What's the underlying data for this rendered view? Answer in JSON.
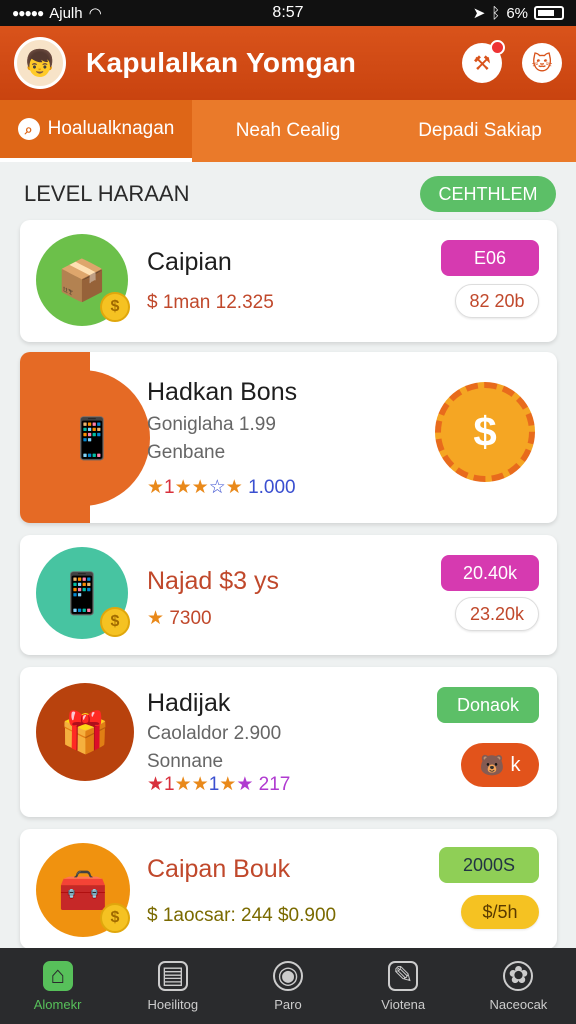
{
  "status_bar": {
    "carrier": "Ajulh",
    "time": "8:57",
    "battery": "6%"
  },
  "header": {
    "title": "Kapulalkan Yomgan"
  },
  "tabs": [
    {
      "label": "Hoalualknagan"
    },
    {
      "label": "Neah Cealig"
    },
    {
      "label": "Depadi Sakiap"
    }
  ],
  "section": {
    "title": "LEVEL HARAAN",
    "action": "CEHTHLEM"
  },
  "cards": [
    {
      "title": "Caipian",
      "line1": "$ 1man 12.325",
      "badge": "E06",
      "value": "82 20b"
    },
    {
      "title": "Hadkan Bons",
      "line1": "Goniglaha 1.99",
      "line2": "Genbane",
      "stars": "1.000"
    },
    {
      "title": "Najad $3 ys",
      "stars": "7300",
      "badge": "20.40k",
      "value": "23.20k"
    },
    {
      "title": "Hadijak",
      "line1": "Caolaldor 2.900",
      "line2": "Sonnane",
      "stars": "217",
      "badge": "Donaok",
      "value_icon_text": "k"
    },
    {
      "title": "Caipan Bouk",
      "line1": "$ 1aocsar: 244  $0.900",
      "badge": "2000S",
      "value": "$/5h"
    }
  ],
  "bottom_nav": [
    {
      "label": "Alomekr"
    },
    {
      "label": "Hoeilitog"
    },
    {
      "label": "Paro"
    },
    {
      "label": "Viotena"
    },
    {
      "label": "Naceocak"
    }
  ],
  "colors": {
    "header": "#c9430f",
    "tabs": "#ea7a2a",
    "magenta": "#d63ab0",
    "green": "#5cbf67",
    "lime": "#8fcf56",
    "gold": "#f5c222"
  }
}
